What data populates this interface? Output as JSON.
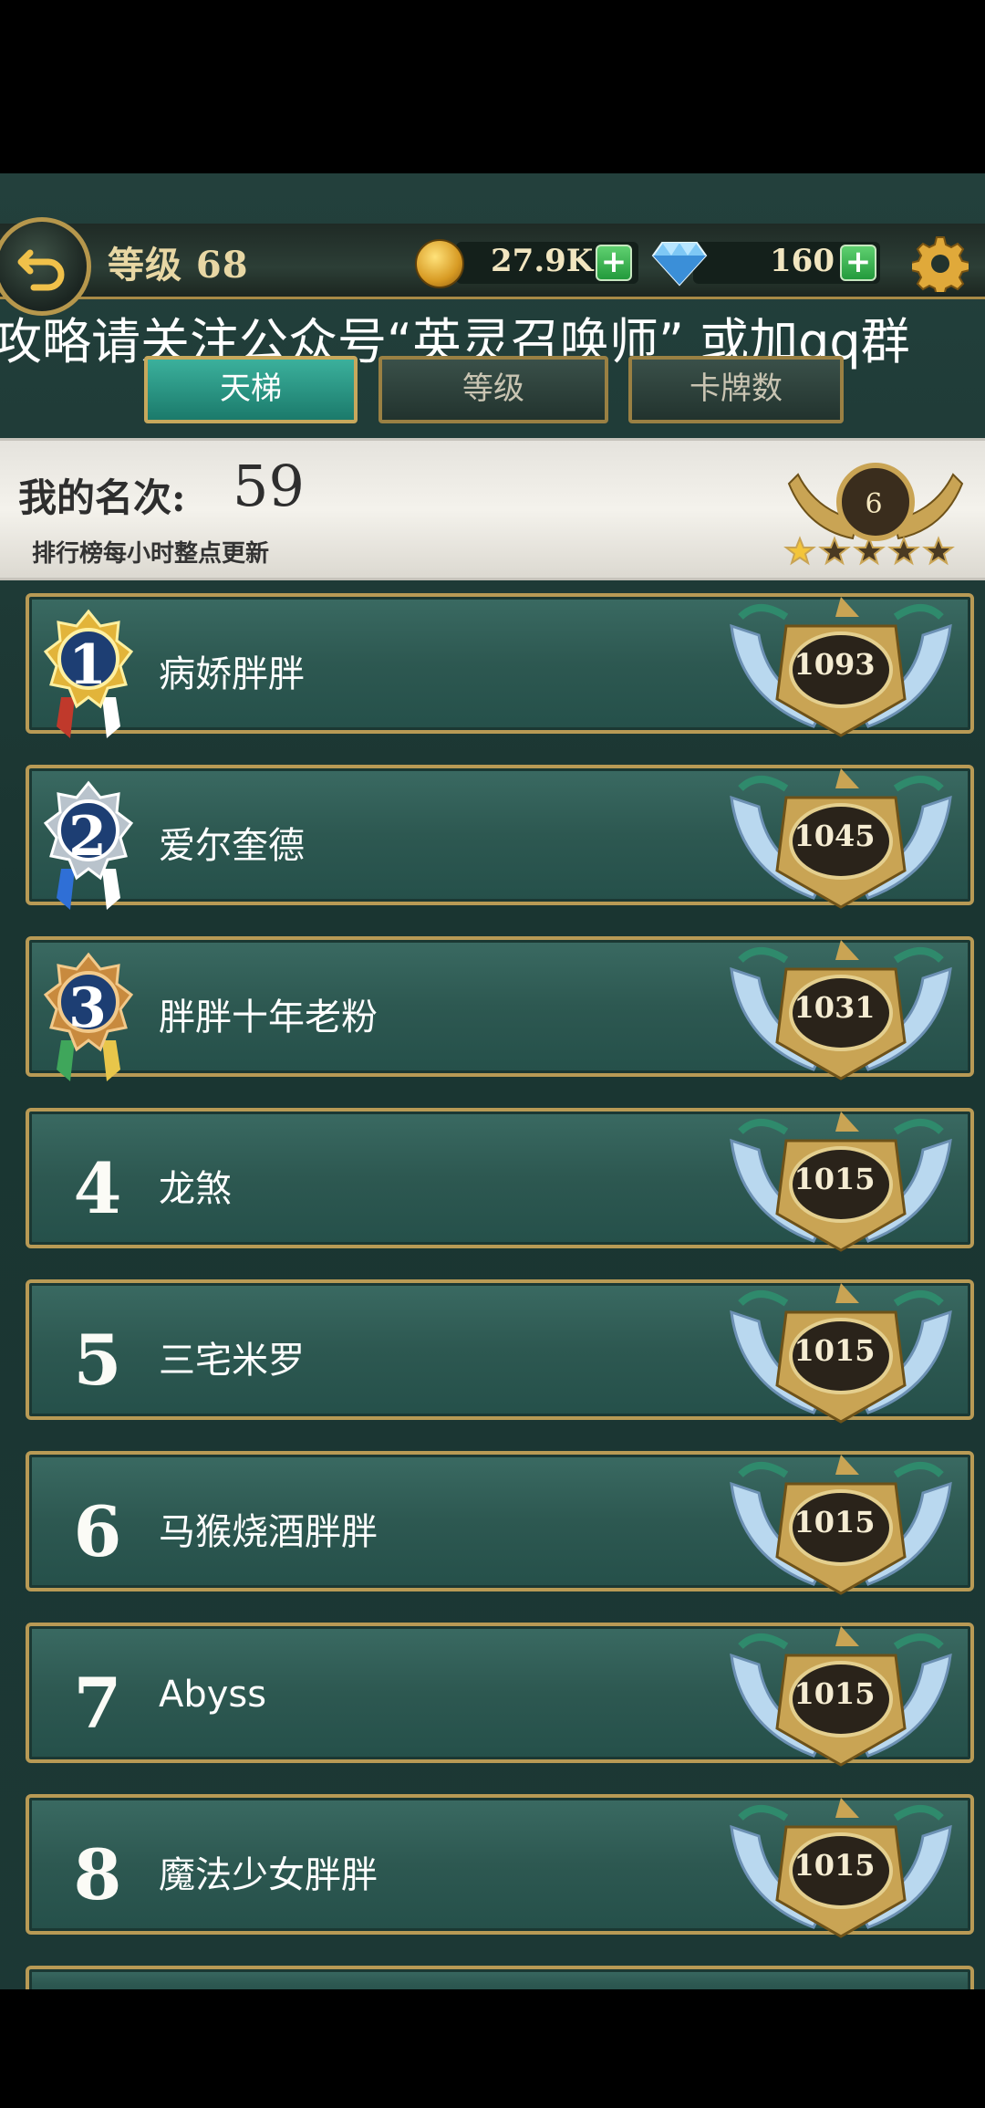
{
  "header": {
    "level_label": "等级 68",
    "coins": "27.9K",
    "gems": "160",
    "plus_glyph": "+"
  },
  "marquee": "攻略请关注公众号“英灵召唤师” 或加qq群",
  "tabs": [
    {
      "label": "天梯",
      "active": true
    },
    {
      "label": "等级",
      "active": false
    },
    {
      "label": "卡牌数",
      "active": false
    }
  ],
  "my_rank": {
    "label": "我的名次:",
    "value": "59",
    "note": "排行榜每小时整点更新",
    "badge_level": "6",
    "stars_filled": 1,
    "stars_total": 5
  },
  "leaderboard": [
    {
      "rank": "1",
      "name": "病娇胖胖",
      "score": "1093"
    },
    {
      "rank": "2",
      "name": "爱尔奎德",
      "score": "1045"
    },
    {
      "rank": "3",
      "name": "胖胖十年老粉",
      "score": "1031"
    },
    {
      "rank": "4",
      "name": "龙煞",
      "score": "1015"
    },
    {
      "rank": "5",
      "name": "三宅米罗",
      "score": "1015"
    },
    {
      "rank": "6",
      "name": "马猴烧酒胖胖",
      "score": "1015"
    },
    {
      "rank": "7",
      "name": "Abyss",
      "score": "1015"
    },
    {
      "rank": "8",
      "name": "魔法少女胖胖",
      "score": "1015"
    }
  ],
  "colors": {
    "gold_border": "#b89a55",
    "row_bg": "#2d5851",
    "active_tab": "#2a9a87"
  }
}
